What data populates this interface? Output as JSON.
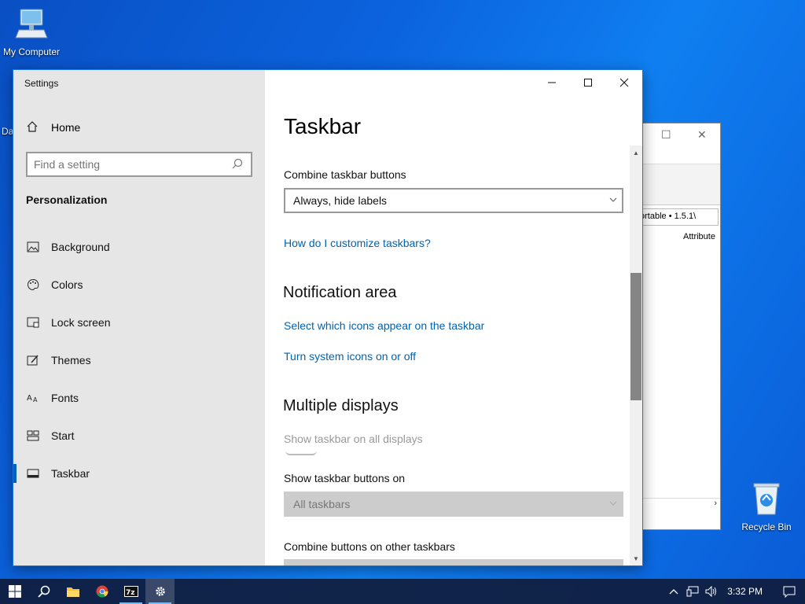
{
  "desktop": {
    "my_computer": "My Computer",
    "recycle_bin": "Recycle Bin",
    "partial_label": "Da"
  },
  "bg_window": {
    "address_partial": "ortable • 1.5.1\\",
    "column_partial": "Attribute"
  },
  "settings": {
    "app_title": "Settings",
    "nav": {
      "home": "Home",
      "search_placeholder": "Find a setting",
      "section": "Personalization",
      "items": [
        {
          "label": "Background",
          "icon": "background-icon"
        },
        {
          "label": "Colors",
          "icon": "palette-icon"
        },
        {
          "label": "Lock screen",
          "icon": "lock-screen-icon"
        },
        {
          "label": "Themes",
          "icon": "themes-icon"
        },
        {
          "label": "Fonts",
          "icon": "fonts-icon"
        },
        {
          "label": "Start",
          "icon": "start-icon"
        },
        {
          "label": "Taskbar",
          "icon": "taskbar-icon",
          "active": true
        }
      ]
    },
    "content": {
      "title": "Taskbar",
      "combine_label": "Combine taskbar buttons",
      "combine_value": "Always, hide labels",
      "customize_link": "How do I customize taskbars?",
      "notification_heading": "Notification area",
      "icons_link": "Select which icons appear on the taskbar",
      "system_icons_link": "Turn system icons on or off",
      "multiple_heading": "Multiple displays",
      "show_all_label": "Show taskbar on all displays",
      "show_buttons_label": "Show taskbar buttons on",
      "show_buttons_value": "All taskbars",
      "combine_other_label": "Combine buttons on other taskbars"
    }
  },
  "taskbar": {
    "clock": "3:32 PM"
  },
  "colors": {
    "accent": "#0063b1",
    "link": "#0063b1"
  }
}
